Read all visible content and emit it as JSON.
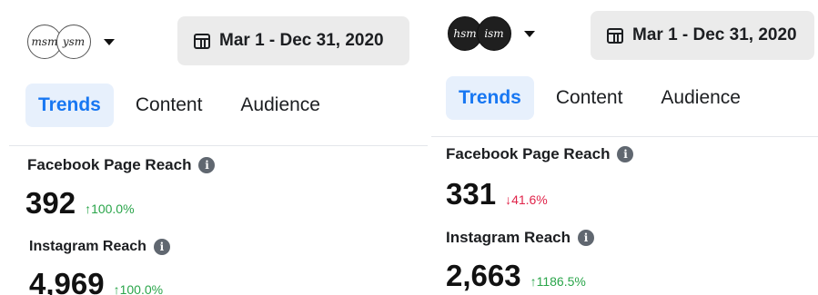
{
  "colors": {
    "accent": "#1877f2",
    "up": "#2aa54a",
    "down": "#e0244a"
  },
  "left": {
    "account": {
      "avatar1": "msm",
      "avatar2": "ysm"
    },
    "date_range": "Mar 1 - Dec 31, 2020",
    "tabs": [
      "Trends",
      "Content",
      "Audience"
    ],
    "facebook": {
      "title": "Facebook Page Reach",
      "value": "392",
      "change": "↑100.0%"
    },
    "instagram": {
      "title": "Instagram Reach",
      "value": "4,969",
      "change": "↑100.0%"
    }
  },
  "right": {
    "account": {
      "avatar1": "hsm",
      "avatar2": "ism"
    },
    "date_range": "Mar 1 - Dec 31, 2020",
    "tabs": [
      "Trends",
      "Content",
      "Audience"
    ],
    "facebook": {
      "title": "Facebook Page Reach",
      "value": "331",
      "change": "↓41.6%"
    },
    "instagram": {
      "title": "Instagram Reach",
      "value": "2,663",
      "change": "↑1186.5%"
    }
  }
}
